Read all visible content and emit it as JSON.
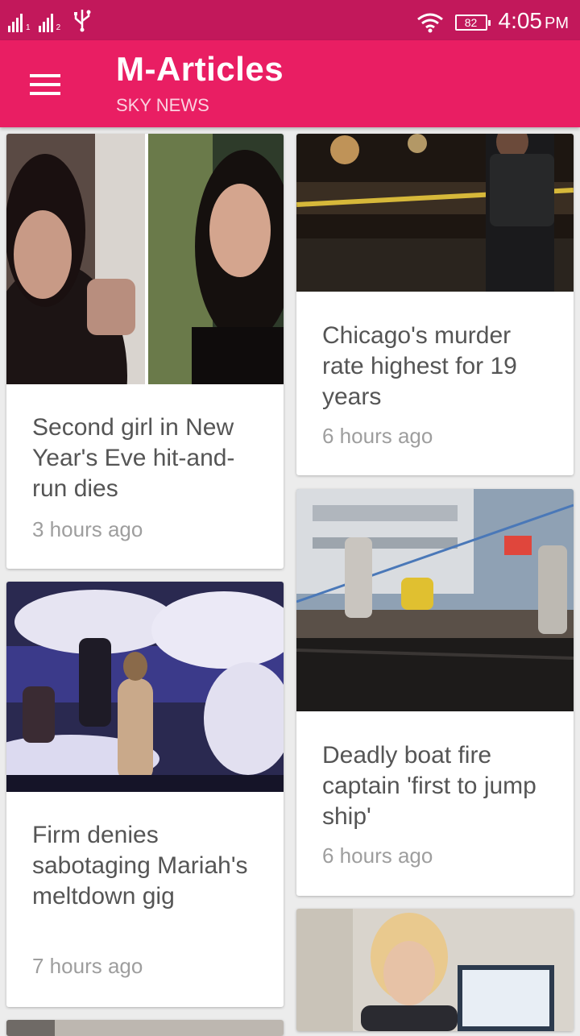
{
  "status_bar": {
    "sim1": "1",
    "sim2": "2",
    "battery": "82",
    "time": "4:05",
    "ampm": "PM"
  },
  "app_bar": {
    "title": "M-Articles",
    "subtitle": "SKY NEWS"
  },
  "articles": [
    {
      "title": "Second girl in New Year's Eve hit-and-run dies",
      "time": "3 hours ago"
    },
    {
      "title": "Chicago's murder rate highest for 19 years",
      "time": "6 hours ago"
    },
    {
      "title": "Firm denies sabotaging Mariah's meltdown gig",
      "time": "7 hours ago"
    },
    {
      "title": "Deadly boat fire captain 'first to jump ship'",
      "time": "6 hours ago"
    }
  ],
  "colors": {
    "status_bar": "#c2185b",
    "app_bar": "#e91e63",
    "background": "#ececec"
  }
}
